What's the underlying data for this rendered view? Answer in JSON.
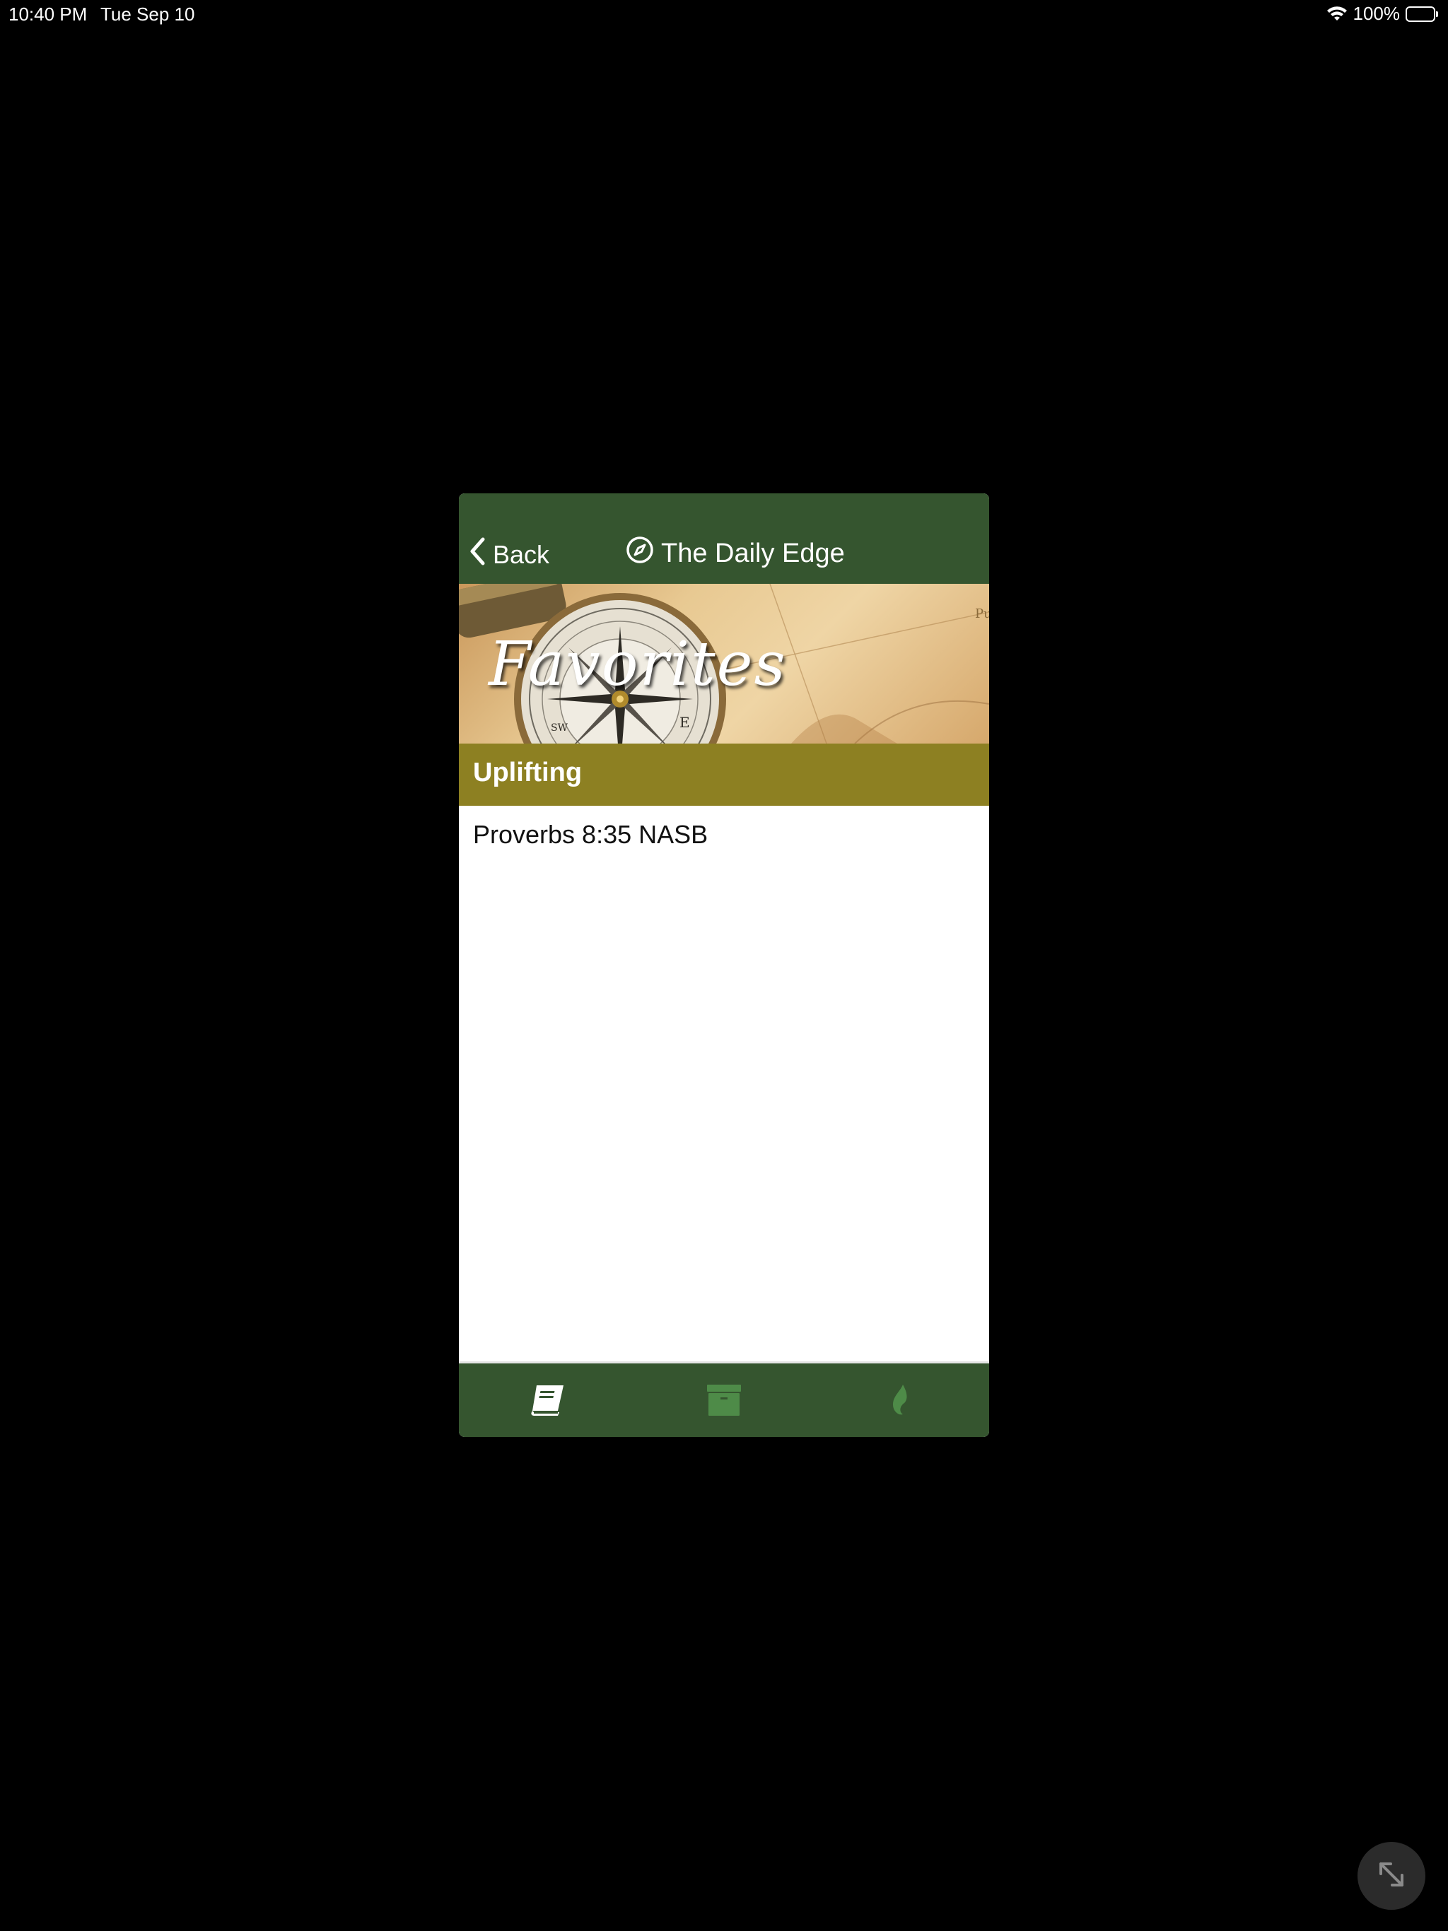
{
  "status_bar": {
    "time": "10:40 PM",
    "date": "Tue Sep 10",
    "battery": "100%"
  },
  "nav": {
    "back_label": "Back",
    "title": "The Daily Edge",
    "title_icon": "compass-icon"
  },
  "banner": {
    "title": "Favorites"
  },
  "category": {
    "label": "Uplifting"
  },
  "favorites": {
    "items": [
      "Proverbs 8:35 NASB"
    ]
  },
  "tabs": [
    {
      "icon": "book-icon"
    },
    {
      "icon": "archive-box-icon"
    },
    {
      "icon": "flame-icon"
    }
  ],
  "colors": {
    "nav_green": "#35552f",
    "category_olive": "#8d8022",
    "icon_green": "#4e8b48"
  }
}
